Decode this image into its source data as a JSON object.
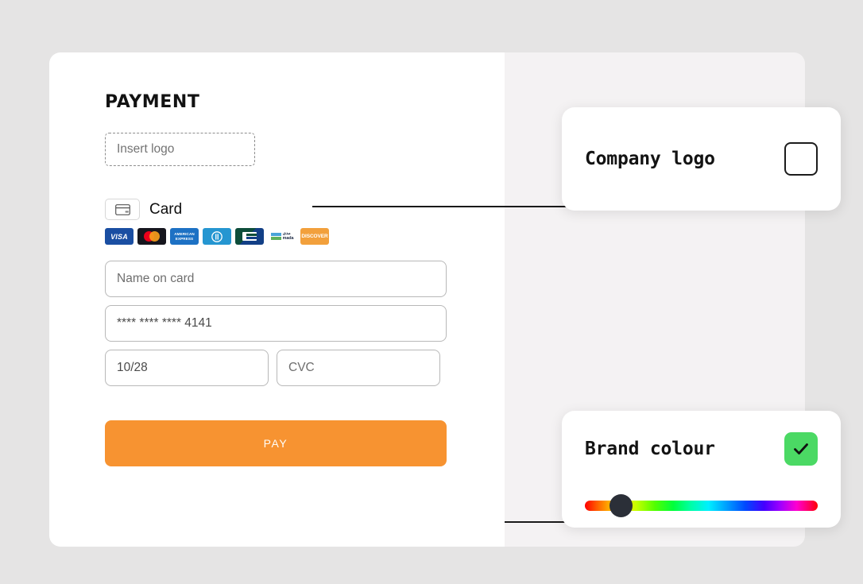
{
  "background_color": "#e5e4e4",
  "panels": {
    "left_bg": "#ffffff",
    "right_bg": "#f4f2f3"
  },
  "payment": {
    "title": "PAYMENT",
    "logo_dropzone": {
      "placeholder": "Insert logo",
      "name": "insert-logo-dropzone"
    },
    "method": {
      "label": "Card",
      "icon": "credit-card-icon"
    },
    "brands": [
      {
        "name": "visa",
        "label": "VISA",
        "color": "#1a4ea2"
      },
      {
        "name": "mastercard",
        "label": "mastercard",
        "color": "#16161e"
      },
      {
        "name": "american-express",
        "label": "AMERICAN EXPRESS",
        "color": "#1d71c4"
      },
      {
        "name": "diners-club",
        "label": "Diners Club",
        "color": "#2596d1"
      },
      {
        "name": "cartes-bancaires",
        "label": "CB",
        "color": "#0d4d3a"
      },
      {
        "name": "mada",
        "label": "mada",
        "color": "#ffffff"
      },
      {
        "name": "discover",
        "label": "DISCOVER",
        "color": "#f2a03c"
      }
    ],
    "fields": {
      "name_on_card": {
        "placeholder": "Name on card",
        "value": ""
      },
      "card_number": {
        "placeholder": "**** **** **** 4141",
        "value": "**** **** **** 4141"
      },
      "expiry": {
        "placeholder": "10/28",
        "value": "10/28"
      },
      "cvc": {
        "placeholder": "CVC",
        "value": ""
      }
    },
    "pay_button": {
      "label": "PAY",
      "color": "#f79331",
      "text_color": "#fffdf8"
    }
  },
  "annotations": {
    "company_logo": {
      "title": "Company logo",
      "swatch_icon": "empty-square-icon"
    },
    "brand_colour": {
      "title": "Brand colour",
      "status_icon": "check-icon",
      "status_color": "#4bd964",
      "slider": {
        "name": "hue-slider",
        "thumb_color": "#2b2f38",
        "thumb_position_percent": 25
      }
    }
  }
}
